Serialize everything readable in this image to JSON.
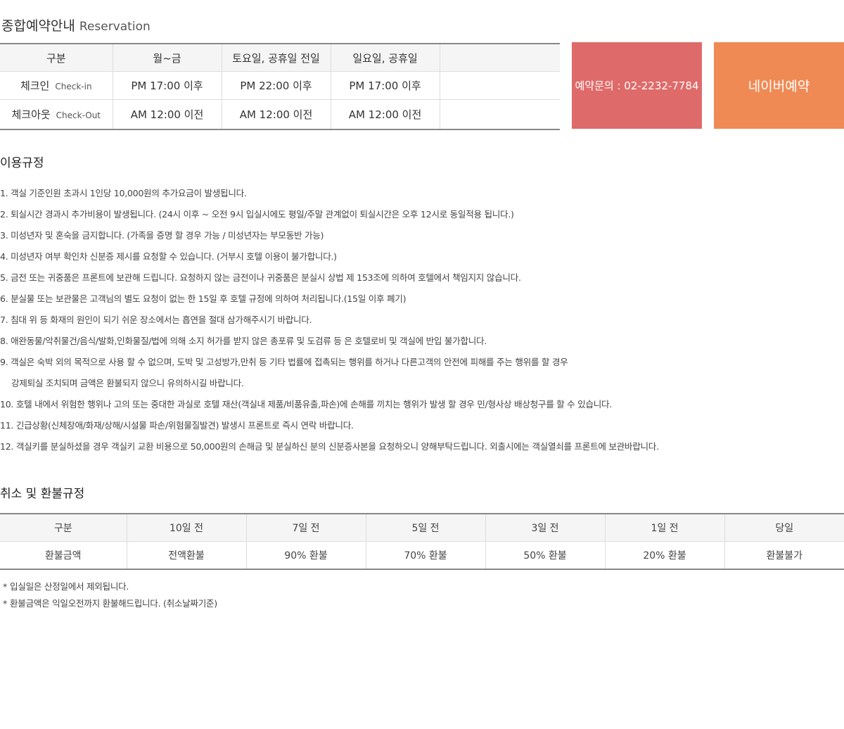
{
  "header": {
    "title_ko": "종합예약안내",
    "title_en": "Reservation"
  },
  "reservation_table": {
    "headers": [
      "구분",
      "월~금",
      "토요일, 공휴일 전일",
      "일요일, 공휴일",
      ""
    ],
    "rows": [
      {
        "label_ko": "체크인",
        "label_en": "Check-in",
        "cells": [
          "PM 17:00 이후",
          "PM 22:00 이후",
          "PM 17:00 이후",
          ""
        ]
      },
      {
        "label_ko": "체크아웃",
        "label_en": "Check-Out",
        "cells": [
          "AM 12:00 이전",
          "AM 12:00 이전",
          "AM 12:00 이전",
          ""
        ]
      }
    ]
  },
  "buttons": {
    "inquiry": "예약문의 : 02-2232-7784",
    "naver": "네이버예약",
    "inquiry_color": "#df6a6a",
    "naver_color": "#f08a55"
  },
  "usage_rules": {
    "title": "이용규정",
    "items": [
      "1. 객실 기준인원 초과시 1인당 10,000원의 추가요금이 발생됩니다.",
      "2. 퇴실시간 경과시 추가비용이 발생됩니다. (24시 이후 ~ 오전 9시 입실시에도 평일/주말 관계없이 퇴실시간은 오후 12시로 동일적용 됩니다.)",
      "3. 미성년자 및 혼숙을 금지합니다. (가족을 증명 할 경우 가능 / 미성년자는 부모동반 가능)",
      "4. 미성년자 여부 확인차 신분증 제시를 요청할 수 있습니다. (거부시 호텔 이용이 불가합니다.)",
      "5. 금전 또는 귀중품은 프론트에 보관해 드립니다. 요청하지 않는 금전이나 귀중품은 분실시 상법 제 153조에 의하여 호텔에서 책임지지 않습니다.",
      "6. 분실물 또는 보관물은 고객님의 별도 요청이 없는 한 15일 후 호텔 규정에 의하여 처리됩니다.(15일 이후 폐기)",
      "7. 침대 위 등 화재의 원인이 되기 쉬운 장소에서는 흡연을 절대 삼가해주시기 바랍니다.",
      "8. 애완동물/악취물건/음식/발화,인화물질/법에 의해 소지 허가를 받지 않은 총포류 및 도검류 등 은 호텔로비 및 객실에 반입 불가합니다.",
      "9. 객실은 숙박 외의 목적으로 사용 할 수 없으며, 도박 및 고성방가,만취 등 기타 법률에 접촉되는 행위를 하거나 다른고객의 안전에 피해를 주는 행위를 할 경우",
      "강제퇴실 조치되며 금액은 환불되지 않으니 유의하시길 바랍니다.",
      "10. 호텔 내에서 위험한 행위나 고의 또는 중대한 과실로 호텔 재산(객실내 제품/비품유출,파손)에 손해를 끼치는 행위가 발생 할 경우 민/형사상 배상청구를 할 수 있습니다.",
      "11. 긴급상황(신체장애/화재/상해/시설물 파손/위험물질발견) 발생시 프론트로 즉시 연락 바랍니다.",
      "12. 객실키를 분실하셨을 경우 객실키 교환 비용으로 50,000원의 손해금 및 분실하신 분의 신분증사본을 요청하오니 양해부탁드립니다. 외출시에는 객실열쇠를 프론트에 보관바랍니다."
    ]
  },
  "refund": {
    "title": "취소 및 환불규정",
    "headers": [
      "구분",
      "10일 전",
      "7일 전",
      "5일 전",
      "3일 전",
      "1일 전",
      "당일"
    ],
    "row": [
      "환불금액",
      "전액환불",
      "90% 환불",
      "70% 환불",
      "50% 환불",
      "20% 환불",
      "환불불가"
    ],
    "notes": [
      "입실일은 산정일에서 제외됩니다.",
      "환불금액은 익일오전까지 환불해드립니다. (취소날짜기준)"
    ],
    "note_marker": "*"
  }
}
